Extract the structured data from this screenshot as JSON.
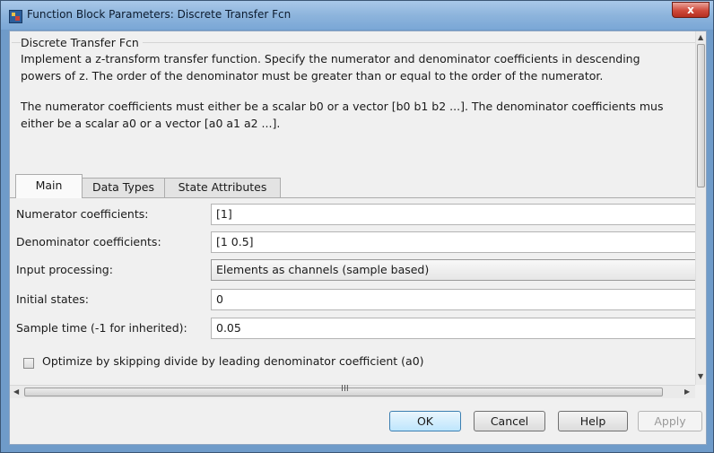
{
  "window": {
    "title": "Function Block Parameters: Discrete Transfer Fcn",
    "close_label": "x"
  },
  "block": {
    "name": "Discrete Transfer Fcn",
    "description_lines": [
      "Implement a z-transform transfer function. Specify the numerator and denominator coefficients in descending",
      "powers of z. The order of the denominator must be greater than or equal to the order of the numerator.",
      "The numerator coefficients must either be a scalar b0 or a vector [b0 b1 b2 ...]. The denominator coefficients mus",
      "either be a scalar a0 or a vector [a0 a1 a2 ...]."
    ]
  },
  "tabs": [
    {
      "label": "Main",
      "active": true
    },
    {
      "label": "Data Types",
      "active": false
    },
    {
      "label": "State Attributes",
      "active": false
    }
  ],
  "params": {
    "numerator": {
      "label": "Numerator coefficients:",
      "value": "[1]"
    },
    "denominator": {
      "label": "Denominator coefficients:",
      "value": "[1 0.5]"
    },
    "input_processing": {
      "label": "Input processing:",
      "value": "Elements as channels (sample based)"
    },
    "initial_states": {
      "label": "Initial states:",
      "value": "0"
    },
    "sample_time": {
      "label": "Sample time (-1 for inherited):",
      "value": "0.05"
    },
    "optimize": {
      "label": "Optimize by skipping divide by leading denominator coefficient (a0)",
      "checked": false
    }
  },
  "scrollbars": {
    "grip": "III"
  },
  "buttons": {
    "ok": "OK",
    "cancel": "Cancel",
    "help": "Help",
    "apply": "Apply"
  }
}
